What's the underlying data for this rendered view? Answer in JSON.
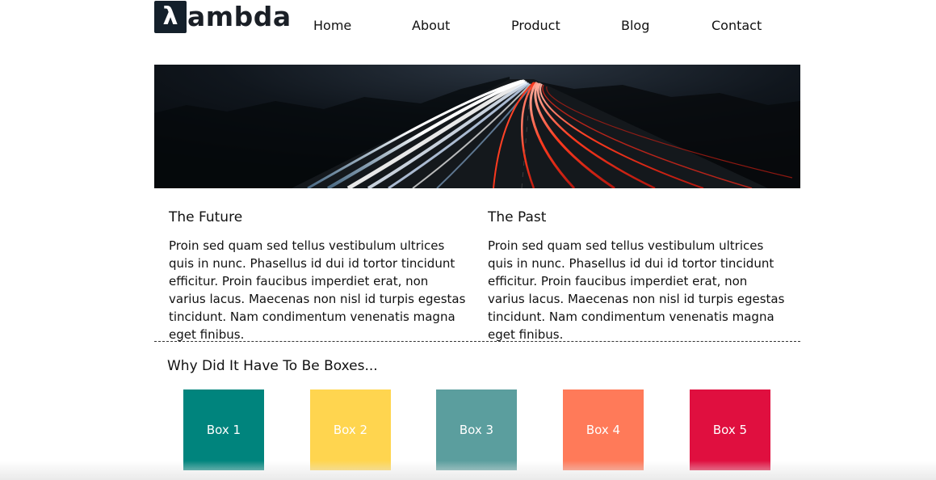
{
  "brand": {
    "mark": "λ",
    "text": "ambda"
  },
  "nav": {
    "items": [
      "Home",
      "About",
      "Product",
      "Blog",
      "Contact"
    ]
  },
  "hero": {
    "image": "night-highway-light-trails"
  },
  "columns": [
    {
      "title": "The Future",
      "body": "Proin sed quam sed tellus vestibulum ultrices quis in nunc. Phasellus id dui id tortor tincidunt efficitur. Proin faucibus imperdiet erat, non varius lacus. Maecenas non nisl id turpis egestas tincidunt. Nam condimentum venenatis magna eget finibus."
    },
    {
      "title": "The Past",
      "body": "Proin sed quam sed tellus vestibulum ultrices quis in nunc. Phasellus id dui id tortor tincidunt efficitur. Proin faucibus imperdiet erat, non varius lacus. Maecenas non nisl id turpis egestas tincidunt. Nam condimentum venenatis magna eget finibus."
    }
  ],
  "boxes_section": {
    "heading": "Why Did It Have To Be Boxes...",
    "boxes": [
      {
        "label": "Box 1",
        "color": "#00847d"
      },
      {
        "label": "Box 2",
        "color": "#ffd54f"
      },
      {
        "label": "Box 3",
        "color": "#5b9e9e"
      },
      {
        "label": "Box 4",
        "color": "#ff7a59"
      },
      {
        "label": "Box 5",
        "color": "#e00f3f"
      }
    ]
  }
}
